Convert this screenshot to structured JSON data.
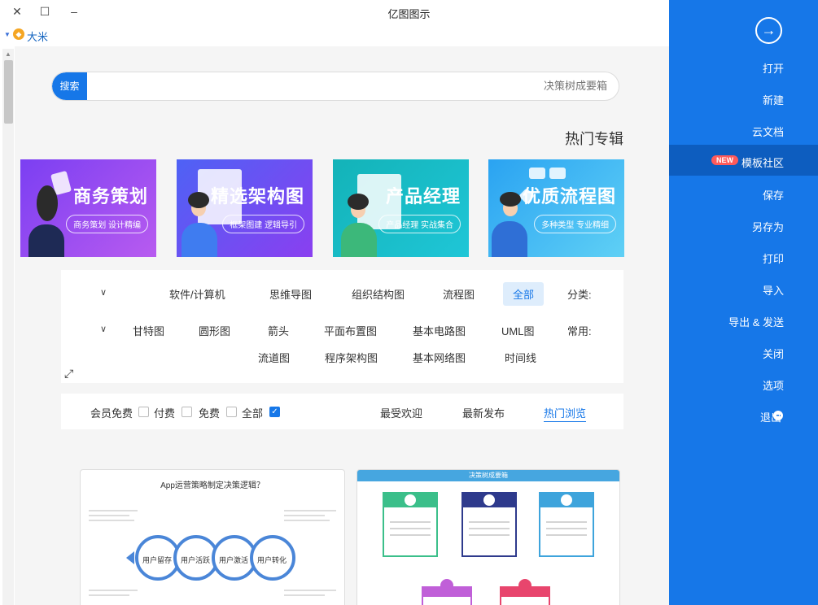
{
  "window": {
    "title": "亿图图示",
    "close": "✕",
    "maximize": "☐",
    "minimize": "–"
  },
  "user": {
    "name": "大米",
    "caret": "▼",
    "gem": "◆"
  },
  "search": {
    "button": "搜索",
    "placeholder": "决策树成要箱"
  },
  "section": {
    "title": "热门专辑"
  },
  "banners": [
    {
      "title": "优质流程图",
      "subtitle": "多种类型 专业精细",
      "gradient_from": "#2aa3f2",
      "gradient_to": "#5fd0f5"
    },
    {
      "title": "产品经理",
      "subtitle": "产品经理 实战集合",
      "gradient_from": "#13b3b8",
      "gradient_to": "#1fc6d7"
    },
    {
      "title": "精选架构图",
      "subtitle": "框架图建 逻辑导引",
      "gradient_from": "#4e62f5",
      "gradient_to": "#8a3ff0"
    },
    {
      "title": "商务策划",
      "subtitle": "商务策划 设计精编",
      "gradient_from": "#7b3ff2",
      "gradient_to": "#b85bf0"
    }
  ],
  "categories": {
    "row1_label": "分类:",
    "row1": [
      "全部",
      "流程图",
      "组织结构图",
      "思维导图",
      "软件/计算机"
    ],
    "row2_label": "常用:",
    "row2": [
      "UML图",
      "基本电路图",
      "平面布置图",
      "箭头",
      "圆形图",
      "甘特图"
    ],
    "row3": [
      "时间线",
      "基本网络图",
      "程序架构图",
      "流道图"
    ]
  },
  "filters": {
    "tabs": [
      "热门浏览",
      "最新发布",
      "最受欢迎"
    ],
    "checks": [
      "全部",
      "免费",
      "付费",
      "会员免费"
    ]
  },
  "cards": [
    {
      "header": "决策树成要箱"
    },
    {
      "title": "App运营策略制定决策逻辑？",
      "nodes": [
        "用户留存",
        "用户活跃",
        "用户激活",
        "用户转化"
      ]
    }
  ],
  "sidebar": {
    "back_icon": "→",
    "items": [
      {
        "label": "打开"
      },
      {
        "label": "新建"
      },
      {
        "label": "云文档"
      },
      {
        "label": "模板社区",
        "badge": "NEW"
      },
      {
        "label": "保存"
      },
      {
        "label": "另存为"
      },
      {
        "label": "打印"
      },
      {
        "label": "导入"
      },
      {
        "label": "导出 & 发送"
      },
      {
        "label": "关闭"
      },
      {
        "label": "选项"
      },
      {
        "label": "退出"
      }
    ]
  }
}
